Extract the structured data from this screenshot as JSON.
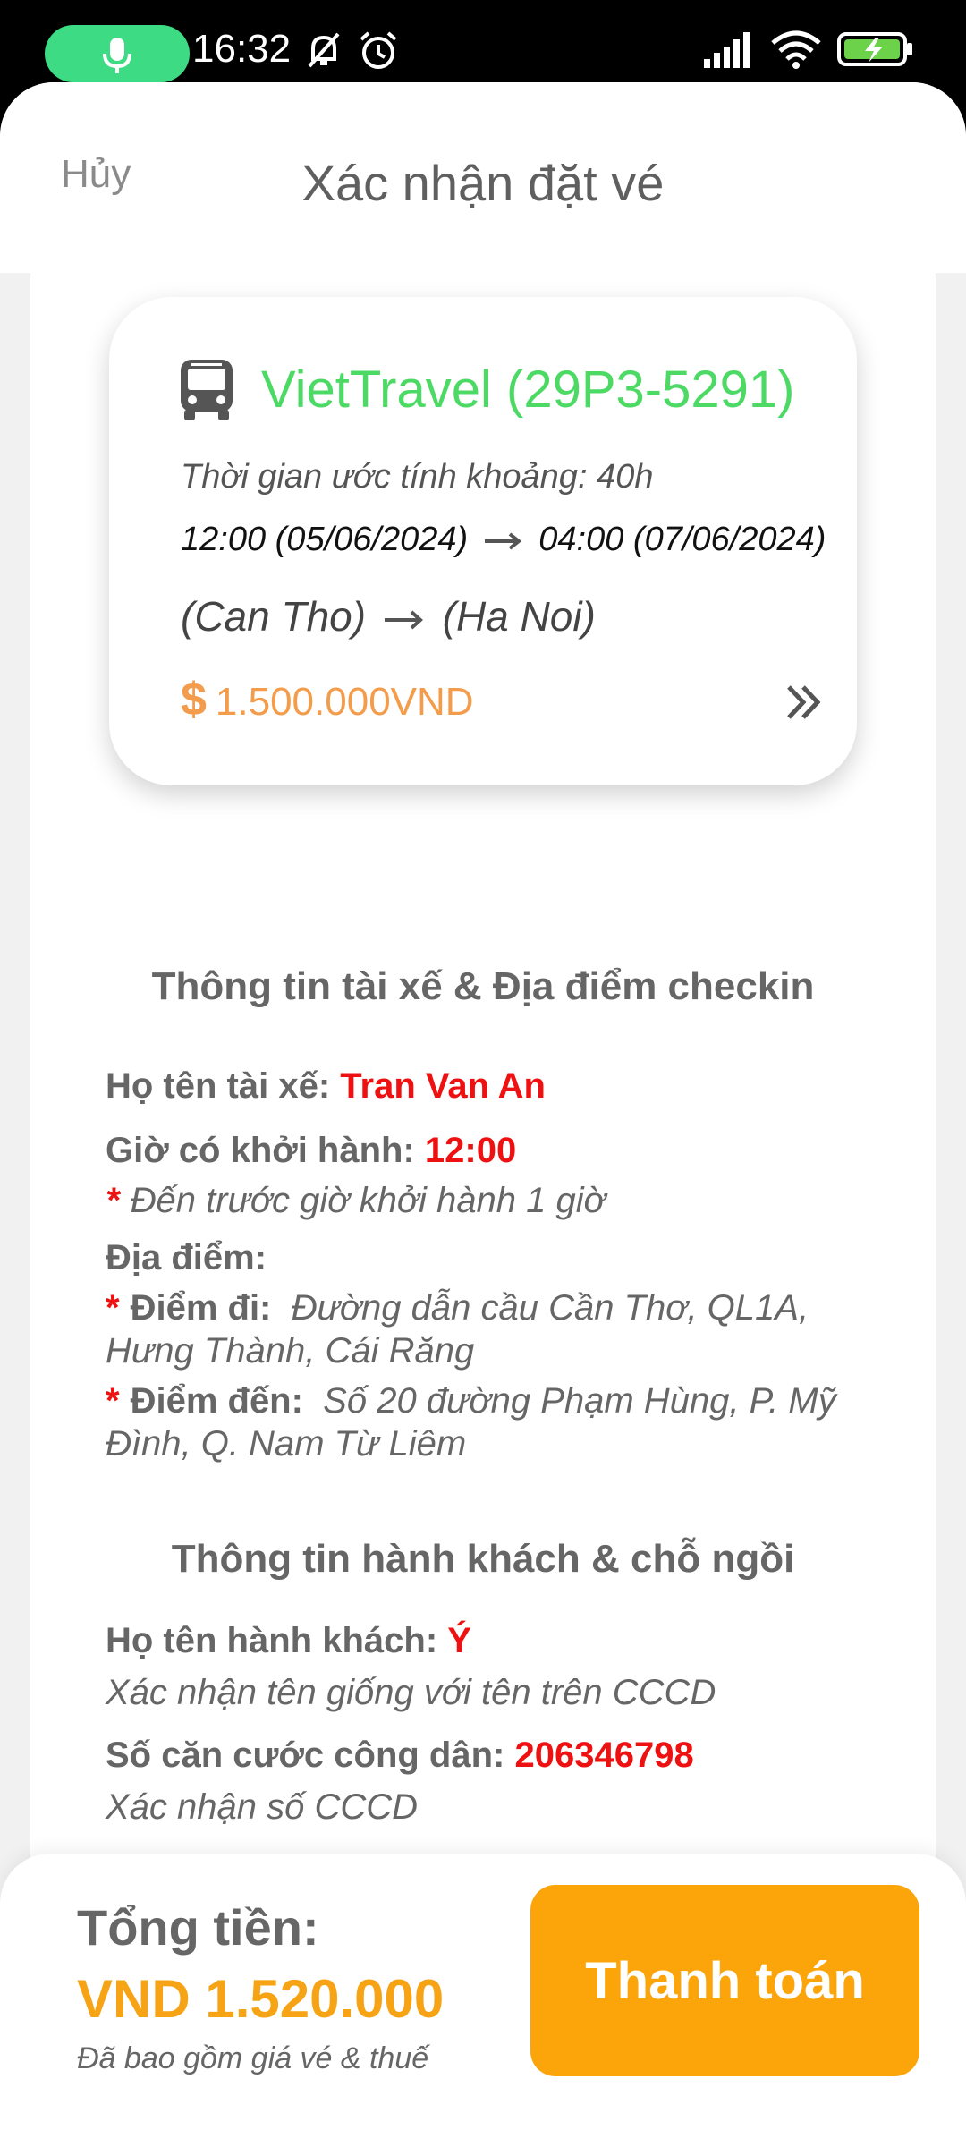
{
  "status_bar": {
    "time": "16:32"
  },
  "header": {
    "cancel_label": "Hủy",
    "title": "Xác nhận đặt vé"
  },
  "trip": {
    "company": "VietTravel (29P3-5291)",
    "duration": "Thời gian ước tính khoảng: 40h",
    "depart": "12:00 (05/06/2024)",
    "arrive": "04:00 (07/06/2024)",
    "origin": "(Can Tho)",
    "destination": "(Ha Noi)",
    "price_symbol": "$",
    "price": "1.500.000VND"
  },
  "driver_section": {
    "title": "Thông tin tài xế & Địa điểm checkin",
    "driver_label": "Họ tên tài xế:",
    "driver_name": "Tran Van An",
    "depart_label": "Giờ có khởi hành:",
    "depart_time": "12:00",
    "arrive_note": "Đến trước giờ khởi hành 1 giờ",
    "location_label": "Địa điểm:",
    "pickup_label": "Điểm đi:",
    "pickup_value": "Đường dẫn cầu Cần Thơ, QL1A, Hưng Thành, Cái Răng",
    "dropoff_label": "Điểm đến:",
    "dropoff_value": "Số 20 đường Phạm Hùng, P. Mỹ Đình, Q. Nam Từ Liêm"
  },
  "passenger_section": {
    "title": "Thông tin hành khách & chỗ ngồi",
    "name_label": "Họ tên hành khách:",
    "name_value": "Ý",
    "name_note": "Xác nhận tên giống với tên trên CCCD",
    "id_label": "Số căn cước công dân:",
    "id_value": "206346798",
    "id_note": "Xác nhận số CCCD"
  },
  "footer": {
    "total_label": "Tổng tiền:",
    "total_value": "VND 1.520.000",
    "total_note": "Đã bao gồm giá vé & thuế",
    "pay_label": "Thanh toán"
  },
  "colors": {
    "company_green": "#4cd964",
    "price_orange": "#f39c4b",
    "highlight_red": "#e11111",
    "pay_button": "#fca50a",
    "total_value": "#f6a416"
  },
  "icons": [
    "mic-icon",
    "mute-icon",
    "alarm-icon",
    "signal-icon",
    "wifi-icon",
    "battery-icon",
    "bus-icon",
    "arrow-right-icon",
    "double-chevron-right-icon"
  ]
}
